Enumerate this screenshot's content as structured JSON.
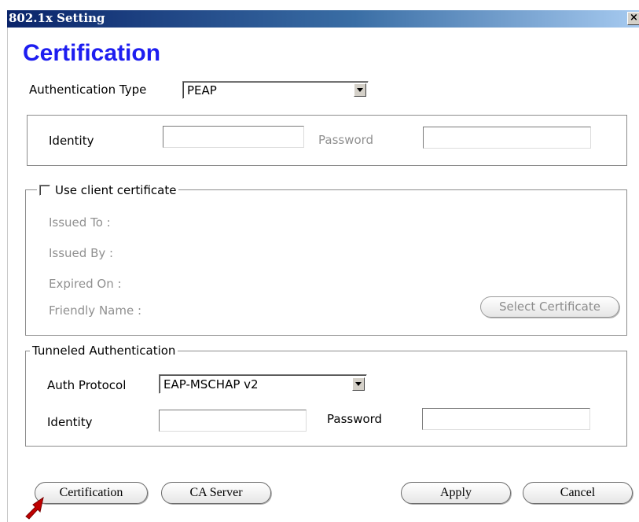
{
  "window": {
    "title": "802.1x Setting",
    "close_symbol": "×"
  },
  "heading": "Certification",
  "auth_type": {
    "label": "Authentication Type",
    "value": "PEAP"
  },
  "identity_box": {
    "identity_label": "Identity",
    "identity_value": "",
    "password_label": "Password",
    "password_value": ""
  },
  "client_cert": {
    "checkbox_label": "Use client certificate",
    "checked": false,
    "issued_to_label": "Issued To :",
    "issued_by_label": "Issued By :",
    "expired_on_label": "Expired On :",
    "friendly_name_label": "Friendly Name :",
    "select_button_label": "Select Certificate"
  },
  "tunneled": {
    "legend": "Tunneled Authentication",
    "protocol_label": "Auth Protocol",
    "protocol_value": "EAP-MSCHAP v2",
    "identity_label": "Identity",
    "identity_value": "",
    "password_label": "Password",
    "password_value": ""
  },
  "buttons": {
    "certification": "Certification",
    "ca_server": "CA Server",
    "apply": "Apply",
    "cancel": "Cancel"
  },
  "colors": {
    "heading": "#1d1df0",
    "titlebar_start": "#0a246a",
    "pointer_arrow": "#c00000"
  },
  "icons": {
    "pointer": "red-arrow-icon",
    "close": "close-icon",
    "dropdown": "chevron-down-icon"
  }
}
